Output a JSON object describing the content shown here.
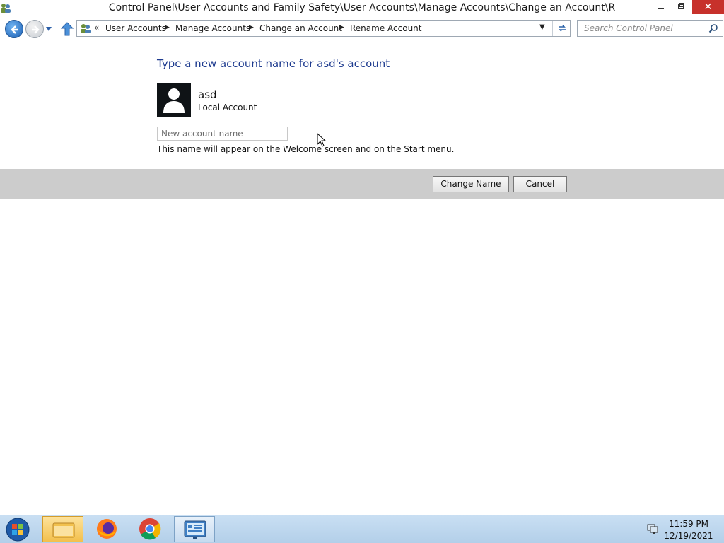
{
  "window": {
    "title": "Control Panel\\User Accounts and Family Safety\\User Accounts\\Manage Accounts\\Change an Account\\R",
    "minimize_label": "🗕",
    "restore_label": "🗗",
    "close_label": "✕"
  },
  "address_bar": {
    "overflow_label": "«",
    "breadcrumbs": [
      "User Accounts",
      "Manage Accounts",
      "Change an Account",
      "Rename Account"
    ]
  },
  "search": {
    "placeholder": "Search Control Panel"
  },
  "content": {
    "heading": "Type a new account name for asd's account",
    "account_name": "asd",
    "account_type": "Local Account",
    "new_name_placeholder": "New account name",
    "new_name_value": "",
    "hint": "This name will appear on the Welcome screen and on the Start menu."
  },
  "actions": {
    "change_name_label": "Change Name",
    "cancel_label": "Cancel"
  },
  "taskbar": {
    "clock_time": "11:59 PM",
    "clock_date": "12/19/2021"
  }
}
